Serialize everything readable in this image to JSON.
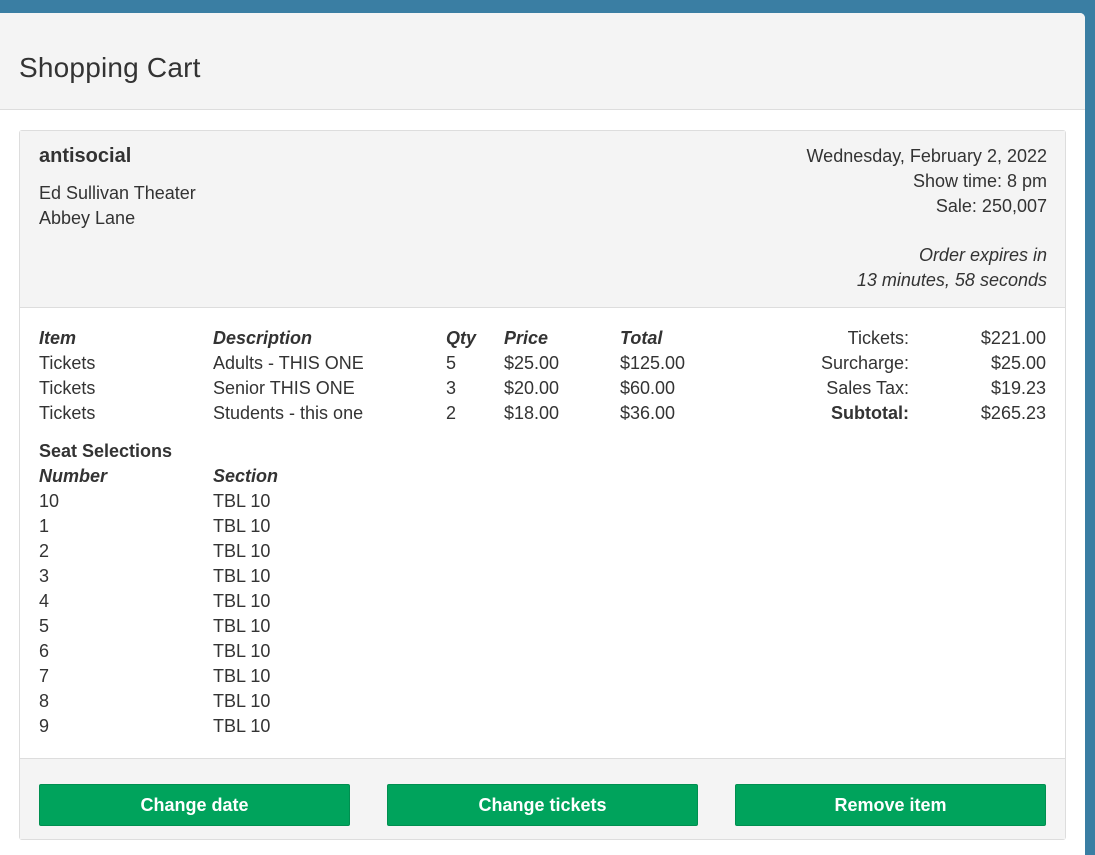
{
  "header": {
    "title": "Shopping Cart"
  },
  "item": {
    "show_name": "antisocial",
    "venue_lines": [
      "Ed Sullivan Theater",
      "Abbey Lane"
    ],
    "date": "Wednesday, February 2, 2022",
    "show_time": "Show time: 8 pm",
    "sale": "Sale: 250,007",
    "expires_line1": "Order expires in",
    "expires_line2": "13 minutes, 58 seconds"
  },
  "line_items": {
    "headers": {
      "item": "Item",
      "description": "Description",
      "qty": "Qty",
      "price": "Price",
      "total": "Total"
    },
    "rows": [
      {
        "item": "Tickets",
        "description": "Adults - THIS ONE",
        "qty": "5",
        "price": "$25.00",
        "total": "$125.00"
      },
      {
        "item": "Tickets",
        "description": "Senior THIS ONE",
        "qty": "3",
        "price": "$20.00",
        "total": "$60.00"
      },
      {
        "item": "Tickets",
        "description": "Students - this one",
        "qty": "2",
        "price": "$18.00",
        "total": "$36.00"
      }
    ]
  },
  "totals": {
    "labels": [
      "Tickets:",
      "Surcharge:",
      "Sales Tax:",
      "Subtotal:"
    ],
    "values": [
      "$221.00",
      "$25.00",
      "$19.23",
      "$265.23"
    ]
  },
  "seats": {
    "title": "Seat Selections",
    "headers": {
      "number": "Number",
      "section": "Section"
    },
    "rows": [
      {
        "number": "10",
        "section": "TBL 10"
      },
      {
        "number": "1",
        "section": "TBL 10"
      },
      {
        "number": "2",
        "section": "TBL 10"
      },
      {
        "number": "3",
        "section": "TBL 10"
      },
      {
        "number": "4",
        "section": "TBL 10"
      },
      {
        "number": "5",
        "section": "TBL 10"
      },
      {
        "number": "6",
        "section": "TBL 10"
      },
      {
        "number": "7",
        "section": "TBL 10"
      },
      {
        "number": "8",
        "section": "TBL 10"
      },
      {
        "number": "9",
        "section": "TBL 10"
      }
    ]
  },
  "buttons": {
    "change_date": "Change date",
    "change_tickets": "Change tickets",
    "remove_item": "Remove item"
  },
  "colors": {
    "background": "#3a7ea3",
    "button": "#00a35c"
  }
}
